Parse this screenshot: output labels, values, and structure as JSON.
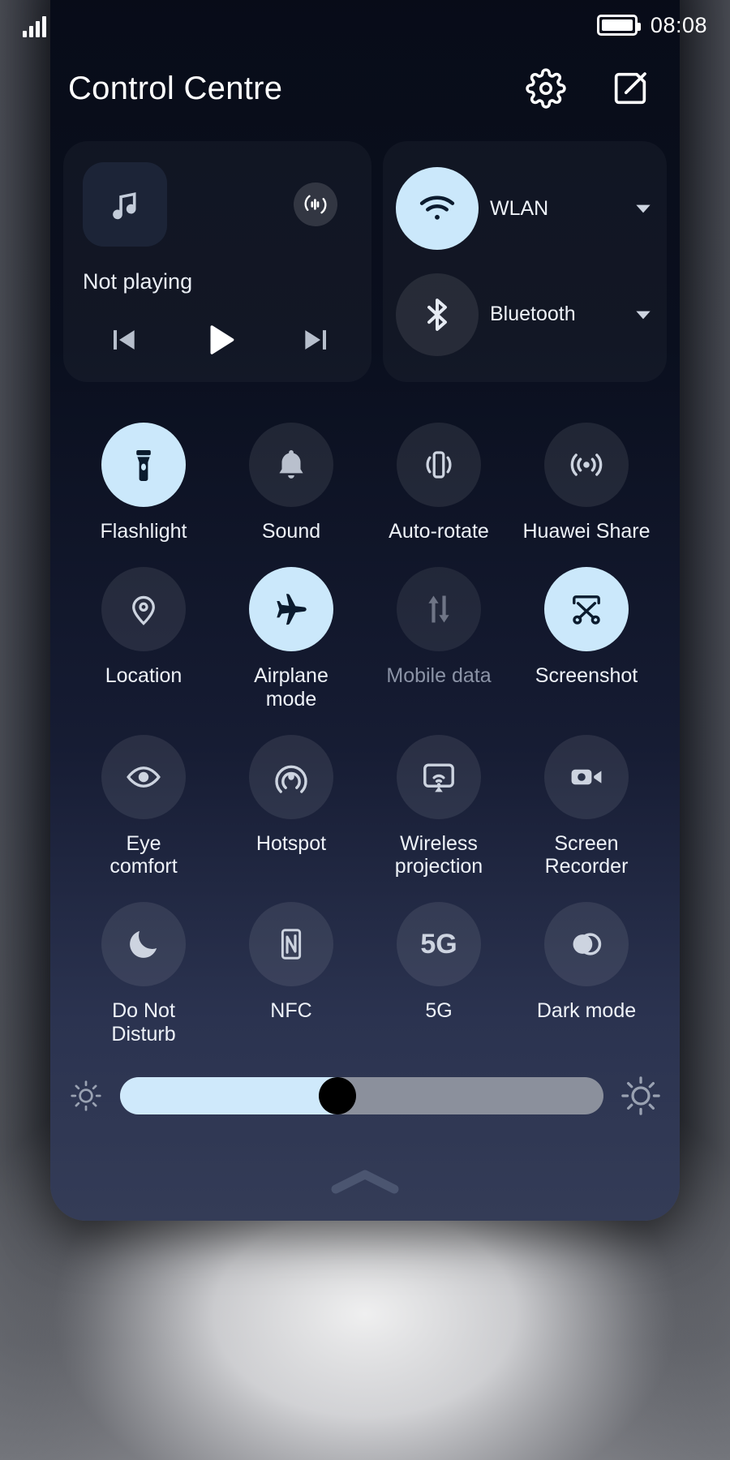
{
  "status_bar": {
    "signal_icon": "signal-bars-icon",
    "battery_icon": "battery-full-icon",
    "time": "08:08"
  },
  "header": {
    "title": "Control Centre",
    "settings_icon": "gear-icon",
    "edit_icon": "edit-pencil-icon"
  },
  "media": {
    "album_icon": "music-note-icon",
    "cast_icon": "audio-cast-icon",
    "title": "Not playing",
    "previous_icon": "skip-previous-icon",
    "play_icon": "play-icon",
    "next_icon": "skip-next-icon"
  },
  "network": {
    "wlan": {
      "label": "WLAN",
      "icon": "wifi-icon",
      "state": "on",
      "caret_icon": "chevron-down-icon"
    },
    "bluetooth": {
      "label": "Bluetooth",
      "icon": "bluetooth-icon",
      "state": "off",
      "caret_icon": "chevron-down-icon"
    }
  },
  "toggles": [
    {
      "label": "Flashlight",
      "icon": "flashlight-icon",
      "state": "on"
    },
    {
      "label": "Sound",
      "icon": "bell-icon",
      "state": "off"
    },
    {
      "label": "Auto-rotate",
      "icon": "auto-rotate-icon",
      "state": "off"
    },
    {
      "label": "Huawei Share",
      "icon": "huawei-share-icon",
      "state": "off"
    },
    {
      "label": "Location",
      "icon": "location-pin-icon",
      "state": "off"
    },
    {
      "label": "Airplane\nmode",
      "icon": "airplane-icon",
      "state": "on"
    },
    {
      "label": "Mobile data",
      "icon": "mobile-data-icon",
      "state": "dim"
    },
    {
      "label": "Screenshot",
      "icon": "screenshot-icon",
      "state": "on"
    },
    {
      "label": "Eye\ncomfort",
      "icon": "eye-icon",
      "state": "off"
    },
    {
      "label": "Hotspot",
      "icon": "hotspot-icon",
      "state": "off"
    },
    {
      "label": "Wireless\nprojection",
      "icon": "wireless-projection-icon",
      "state": "off"
    },
    {
      "label": "Screen\nRecorder",
      "icon": "screen-recorder-icon",
      "state": "off"
    },
    {
      "label": "Do Not\nDisturb",
      "icon": "moon-icon",
      "state": "off"
    },
    {
      "label": "NFC",
      "icon": "nfc-icon",
      "state": "off"
    },
    {
      "label": "5G",
      "icon": "5g-text-icon",
      "state": "off",
      "glyph": "5G"
    },
    {
      "label": "Dark mode",
      "icon": "dark-mode-icon",
      "state": "off"
    }
  ],
  "brightness": {
    "min_icon": "brightness-low-icon",
    "max_icon": "brightness-high-icon",
    "value": 45
  },
  "collapse": {
    "icon": "chevron-up-icon"
  },
  "colors": {
    "accent_on": "#cbe8fb",
    "icon_on": "#0b1b2e",
    "panel_top": "#080c18",
    "panel_bottom": "#343c57",
    "text": "#eef2f8",
    "text_dim": "#8b93a6"
  }
}
